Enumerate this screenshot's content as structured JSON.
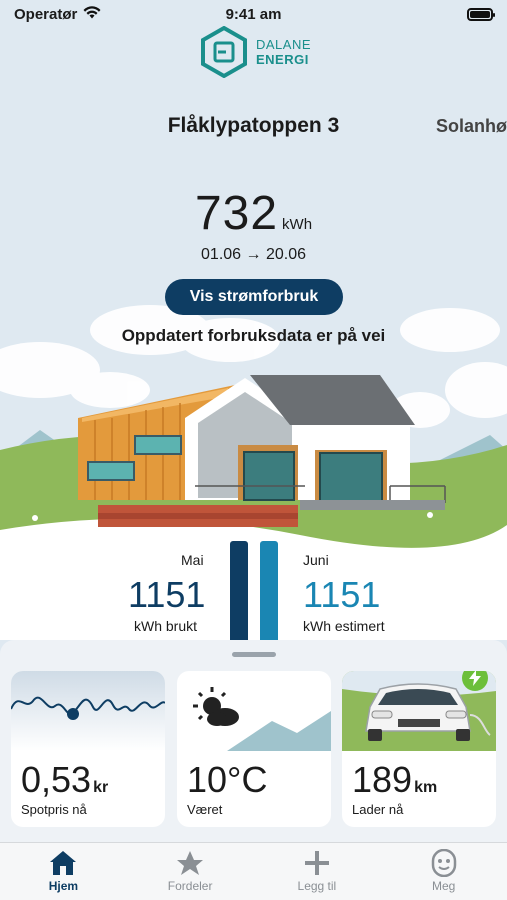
{
  "status": {
    "carrier": "Operatør",
    "time": "9:41 am"
  },
  "logo": {
    "line1": "DALANE",
    "line2": "ENERGI"
  },
  "location": {
    "current": "Flåklypatoppen 3",
    "next": "Solanhø"
  },
  "usage": {
    "value": "732",
    "unit": "kWh",
    "range": "01.06 → 20.06",
    "button_label": "Vis strømforbruk",
    "update_text": "Oppdatert forbruksdata er på vei"
  },
  "comparison": {
    "left": {
      "month": "Mai",
      "value": "1151",
      "label": "kWh brukt"
    },
    "right": {
      "month": "Juni",
      "value": "1151",
      "label": "kWh estimert"
    }
  },
  "cards": [
    {
      "value": "0,53",
      "unit": "kr",
      "label": "Spotpris nå"
    },
    {
      "value": "10°C",
      "unit": "",
      "label": "Været"
    },
    {
      "value": "189",
      "unit": "km",
      "label": "Lader nå"
    }
  ],
  "tabs": [
    {
      "label": "Hjem",
      "icon": "home-icon"
    },
    {
      "label": "Fordeler",
      "icon": "star-icon"
    },
    {
      "label": "Legg til",
      "icon": "plus-icon"
    },
    {
      "label": "Meg",
      "icon": "face-icon"
    }
  ],
  "colors": {
    "primary": "#0e3d63",
    "accent": "#1a86b3",
    "brand": "#1a8f8c",
    "charging": "#6cbf3a"
  }
}
